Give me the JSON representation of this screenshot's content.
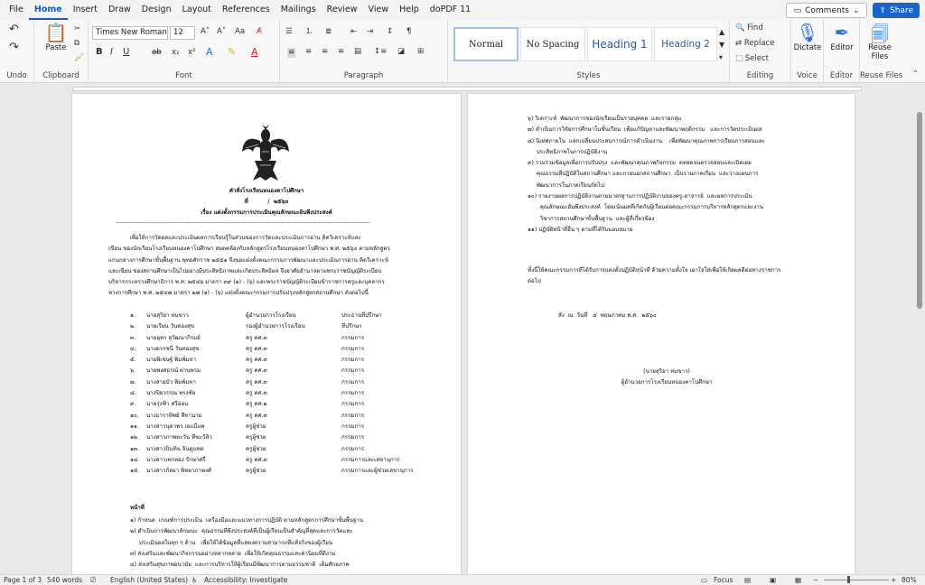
{
  "menu": {
    "tabs": [
      "File",
      "Home",
      "Insert",
      "Draw",
      "Design",
      "Layout",
      "References",
      "Mailings",
      "Review",
      "View",
      "Help",
      "doPDF 11"
    ],
    "active": "Home",
    "comments_label": "Comments",
    "share_label": "Share"
  },
  "ribbon": {
    "undo_label": "Undo",
    "clipboard": {
      "paste_label": "Paste",
      "group_label": "Clipboard"
    },
    "font": {
      "name": "Times New Roman",
      "size": "12",
      "group_label": "Font"
    },
    "paragraph": {
      "group_label": "Paragraph"
    },
    "styles": {
      "items": [
        "Normal",
        "No Spacing",
        "Heading 1",
        "Heading 2"
      ],
      "group_label": "Styles"
    },
    "editing": {
      "find": "Find",
      "replace": "Replace",
      "select": "Select",
      "group_label": "Editing"
    },
    "voice": {
      "dictate": "Dictate",
      "group_label": "Voice"
    },
    "editor": {
      "label": "Editor",
      "group_label": "Editor"
    },
    "reuse": {
      "label": "Reuse Files",
      "group_label": "Reuse Files"
    }
  },
  "doc": {
    "p1": {
      "title": "คำสั่งโรงเรียนหนองคาโปศึกษา",
      "number": "ที่          /  ๒๕๖๐",
      "subject": "เรื่อง แต่งตั้งกรรมการประเมินคุณลักษณะอันพึงประสงค์",
      "separator": "................................................................................................................................................................................................",
      "intro": [
        "            เพื่อให้การวัดผลและประเมินผลการเรียนรู้ในส่วนของการวัดและประเมินการอ่าน คิดวิเคราะห์และ",
        "เขียน ของนักเรียนโรงเรียนหนองคาโปศึกษา สอดคล้องกับหลักสูตรโรงเรียนหนองคาโปศึกษา พ.ศ. ๒๕๖๐ ตามหลักสูตร",
        "แกนกลางการศึกษาขั้นพื้นฐาน พุทธศักราช ๒๕๕๑ จึงขอแต่งตั้งคณะกรรมการพัฒนาและประเมินการอ่าน คิดวิเคราะห์",
        "และเขียน ของสถานศึกษาเป็นไปอย่างมีประสิทธิภาพและเกิดประสิทธิผล จึงอาศัยอำนาจตามพระราชบัญญัติระเบียบ",
        "บริหารกระทรวงศึกษาธิการ พ.ศ. ๒๕๔๖ มาตรา ๓๙ (๑) - (๖) และพระราชบัญญัติระเบียบข้าราชการครูและบุคลากร",
        "ทางการศึกษา พ.ศ. ๒๕๔๗ มาตรา ๒๗ (๑) - (๖) แต่งตั้งคณะกรรมการปรับปรุงหลักสูตรสถานศึกษา ดังต่อไปนี้"
      ],
      "staff": [
        {
          "no": "๑.",
          "name": "นายสุริยา  ห่มขาว",
          "position": "ผู้อำนวยการโรงเรียน",
          "role": "ประธานที่ปรึกษา"
        },
        {
          "no": "๒.",
          "name": "นายเรียน  วันทองสุข",
          "position": "รองผู้อำนวยการโรงเรียน",
          "role": "ที่ปรึกษา"
        },
        {
          "no": "๓.",
          "name": "นายอุทร  สุวัฒนากิรมย์",
          "position": "ครู คศ.๓",
          "role": "กรรมการ"
        },
        {
          "no": "๔.",
          "name": "นางดรรชนี  วันทองสุข",
          "position": "ครู คศ.๓",
          "role": "กรรมการ"
        },
        {
          "no": "๕.",
          "name": "นายพิเชษฐ์  พิมพ์มหา",
          "position": "ครู คศ.๓",
          "role": "กรรมการ"
        },
        {
          "no": "๖.",
          "name": "นายพงศธรณ์  ผ่านพรม",
          "position": "ครู คศ.๓",
          "role": "กรรมการ"
        },
        {
          "no": "๗.",
          "name": "นางสายบัว  พิมพ์มหา",
          "position": "ครู คศ.๓",
          "role": "กรรมการ"
        },
        {
          "no": "๘.",
          "name": "นางปิยวรรณ  ทรงชัย",
          "position": "ครู คศ.๓",
          "role": "กรรมการ"
        },
        {
          "no": "๙.",
          "name": "นายรุ่งฟ้า  ศรีอ่อน",
          "position": "ครู คศ.๒",
          "role": "กรรมการ"
        },
        {
          "no": "๑๐.",
          "name": "นางธาราทิพย์  สีหานาม",
          "position": "ครู คศ.๓",
          "role": "กรรมการ"
        },
        {
          "no": "๑๑.",
          "name": "นางสาวนุดาพร  เยแมีแพ",
          "position": "ครูผู้ช่วย",
          "role": "กรรมการ"
        },
        {
          "no": "๑๒.",
          "name": "นางสาวภาพตะวัน  ทีฆะวิลิว",
          "position": "ครูผู้ช่วย",
          "role": "กรรมการ"
        },
        {
          "no": "๑๓.",
          "name": "นางสาวปิ่นทิน  จินดูบทด",
          "position": "ครูผู้ช่วย",
          "role": "กรรมการ"
        },
        {
          "no": "๑๔.",
          "name": "นางสาวเพรทอง  รักษาศรี",
          "position": "ครู คศ.๓",
          "role": "กรรมการและเลขานุการ"
        },
        {
          "no": "๑๕.",
          "name": "นางสาวกัลยา  พิทยาภาพงศ์",
          "position": "ครูผู้ช่วย",
          "role": "กรรมการและผู้ช่วยเลขานุการ"
        }
      ],
      "duties_title": "หน้าที่",
      "duties": [
        "๑) กำหนด  เกณฑ์การประเมิน  เครื่องมือและแนวทางการปฏิบัติ ตามหลักสูตรการศึกษาขั้นพื้นฐาน",
        "๒) ดำเนินการพัฒนาลักษณะ  คุณธรรมที่พึงประสงค์ที่เป็นผู้เรียนเป็นสำคัญที่สุดและการวัดและ",
        "     ประเมินผลในทุก ๆ ด้าน   เพื่อให้ได้ข้อมูลที่แสดงความสามารถที่แท้จริงของผู้เรียน",
        "๓) ส่งเสริมและพัฒนากิจกรรมอย่างหลากหลาย  เพื่อให้เกิดคุณธรรมและค่านิยมที่ดีงาม",
        "๔) ส่งเสริมสุขภาพอนามัย  และการบริหารให้ผู้เรียนมีพัฒนาการตามธรรมชาติ  เต็มศักยภาพ"
      ]
    },
    "p2": {
      "lines": [
        "๖) วิเคราะห์  พัฒนาการของนักเรียนเป็นรายบุคคล  และรายกลุ่ม",
        "๗) ดำเนินการวิจัยการศึกษาในชั้นเรียน  เพื่อแก้ปัญหาและพัฒนาพฤติกรรม   และการวัดประเมินผล",
        "๘) นิเทศภายใน  แลกเปลี่ยนประสบการณ์การดำเนินงาน    เพื่อพัฒนาคุณภาพการเรียนการสอนและ",
        "     ประสิทธิภาพในการปฏิบัติงาน",
        "๙) รวบรวมข้อมูลเพื่อการปรับปรุง  และพัฒนาคุณภาพกิจกรรม  ตลอดจนตรวจสอบและเปิดเผย",
        "     คุณธรรมที่ปฏิบัติในสถานศึกษา และภายนอกสถานศึกษา  เป็นรายภาคเรียน  และวางแผนการ",
        "     พัฒนาการในภาคเรียนถัดไป",
        "๑๐) รายงานผลการปฏิบัติงานตามมาตรฐานการปฏิบัติงานของครู-อาจารย์  และผลการประเมิน",
        "       คุณลักษณะอันพึงประสงค์  โดยเน้นผลที่เกิดกับผู้เรียนต่อคณะกรรมการบริหารหลักสูตรและงาน",
        "       วิชาการสถานศึกษาขั้นพื้นฐาน  และผู้ที่เกี่ยวข้อง",
        "๑๑) ปฏิบัติหน้าที่อื่น ๆ ตามที่ได้รับมอบหมาย"
      ],
      "closing": [
        "ทั้งนี้ให้คณะกรรมการที่ได้รับการแต่งตั้งปฏิบัติหน้าที่ ด้วยความตั้งใจ เอาใจใส่เพื่อให้เกิดผลดีต่อทางราชการ",
        "ต่อไป"
      ],
      "date": "สั่ง  ณ  วันที่   ๔  พฤษภาคม พ.ศ.  ๒๕๖๐",
      "signer": "(นายสุริยา  ห่มขาว)",
      "signer_title": "ผู้อำนวยการโรงเรียนหนองคาโปศึกษา"
    }
  },
  "status": {
    "page": "Page 1 of 3",
    "words": "540 words",
    "language": "English (United States)",
    "accessibility": "Accessibility: Investigate",
    "focus": "Focus",
    "zoom": "80%"
  },
  "colors": {
    "accent": "#185abd",
    "share": "#1a64c8",
    "heading": "#2f5496"
  }
}
